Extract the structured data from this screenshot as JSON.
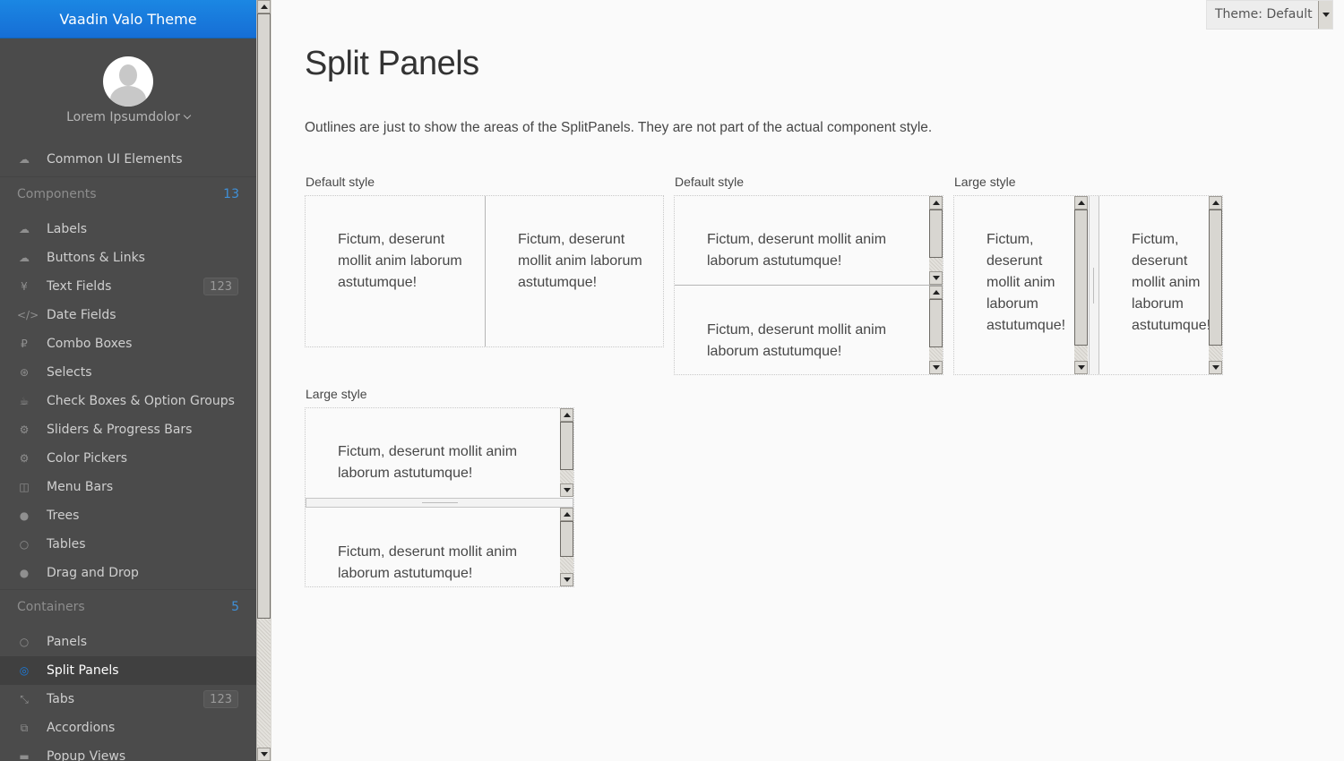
{
  "app": {
    "title": "Vaadin Valo Theme"
  },
  "user": {
    "name": "Lorem Ipsumdolor"
  },
  "nav": {
    "common": {
      "label": "Common UI Elements",
      "icon": "cloud-icon"
    },
    "components_caption": {
      "label": "Components",
      "count": "13"
    },
    "components": [
      {
        "label": "Labels",
        "icon": "cloud-upload-icon"
      },
      {
        "label": "Buttons & Links",
        "icon": "cloud-download-icon"
      },
      {
        "label": "Text Fields",
        "icon": "yen-icon",
        "badge": "123"
      },
      {
        "label": "Date Fields",
        "icon": "code-icon"
      },
      {
        "label": "Combo Boxes",
        "icon": "ruble-icon"
      },
      {
        "label": "Selects",
        "icon": "support-icon"
      },
      {
        "label": "Check Boxes & Option Groups",
        "icon": "coffee-icon"
      },
      {
        "label": "Sliders & Progress Bars",
        "icon": "gear-icon"
      },
      {
        "label": "Color Pickers",
        "icon": "gears-icon"
      },
      {
        "label": "Menu Bars",
        "icon": "columns-icon"
      },
      {
        "label": "Trees",
        "icon": "comment-icon"
      },
      {
        "label": "Tables",
        "icon": "comment-outline-icon"
      },
      {
        "label": "Drag and Drop",
        "icon": "comments-icon"
      }
    ],
    "containers_caption": {
      "label": "Containers",
      "count": "5"
    },
    "containers": [
      {
        "label": "Panels",
        "icon": "comments-outline-icon"
      },
      {
        "label": "Split Panels",
        "icon": "compass-icon",
        "selected": true
      },
      {
        "label": "Tabs",
        "icon": "compress-icon",
        "badge": "123"
      },
      {
        "label": "Accordions",
        "icon": "copy-icon"
      },
      {
        "label": "Popup Views",
        "icon": "credit-card-icon"
      }
    ]
  },
  "theme_select": {
    "value": "Theme: Default"
  },
  "main": {
    "title": "Split Panels",
    "description": "Outlines are just to show the areas of the SplitPanels. They are not part of the actual component style.",
    "panels": {
      "p1": {
        "caption": "Default style",
        "first": "Fictum, deserunt mollit anim laborum astutumque!",
        "second": "Fictum, deserunt mollit anim laborum astutumque!"
      },
      "p2": {
        "caption": "Default style",
        "first": "Fictum, deserunt mollit anim laborum astutumque!",
        "second": "Fictum, deserunt mollit anim laborum astutumque!"
      },
      "p3": {
        "caption": "Large style",
        "first": "Fictum, deserunt mollit anim laborum astutumque!",
        "second": "Fictum, deserunt mollit anim laborum astutumque!"
      },
      "p4": {
        "caption": "Large style",
        "first": "Fictum, deserunt mollit anim laborum astutumque!",
        "second": "Fictum, deserunt mollit anim laborum astutumque!"
      }
    }
  }
}
